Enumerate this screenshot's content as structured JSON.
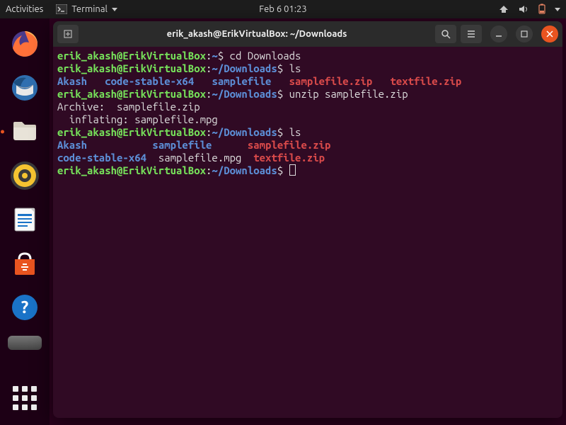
{
  "topbar": {
    "activities": "Activities",
    "appname": "Terminal",
    "datetime": "Feb 6  01:23"
  },
  "dock": {
    "items": [
      {
        "name": "firefox-icon"
      },
      {
        "name": "thunderbird-icon"
      },
      {
        "name": "files-icon",
        "active": true
      },
      {
        "name": "rhythmbox-icon"
      },
      {
        "name": "libreoffice-writer-icon"
      },
      {
        "name": "ubuntu-software-icon"
      },
      {
        "name": "help-icon"
      }
    ]
  },
  "window": {
    "title": "erik_akash@ErikVirtualBox: ~/Downloads"
  },
  "prompt": {
    "userhost": "erik_akash@ErikVirtualBox",
    "sep": ":",
    "home": "~",
    "downloads": "~/Downloads",
    "sign": "$"
  },
  "term": {
    "cmd1": " cd Downloads",
    "cmd2": " ls",
    "cmd3": " unzip samplefile.zip",
    "cmd4": " ls",
    "ls1": {
      "c1": "Akash",
      "c2": "code-stable-x64",
      "c3": "samplefile",
      "c4": "samplefile.zip",
      "c5": "textfile.zip"
    },
    "unzip": {
      "l1": "Archive:  samplefile.zip",
      "l2": "  inflating: samplefile.mpg"
    },
    "ls2": {
      "a1": "Akash",
      "a2": "samplefile",
      "a3": "samplefile.zip",
      "b1": "code-stable-x64",
      "b2": "samplefile.mpg",
      "b3": "textfile.zip"
    },
    "pad": {
      "sp3": "   ",
      "sp2": "  ",
      "ls2_a1_pad": "           ",
      "ls2_a2_pad": "      ",
      "ls2_b2_pad": "  "
    }
  }
}
